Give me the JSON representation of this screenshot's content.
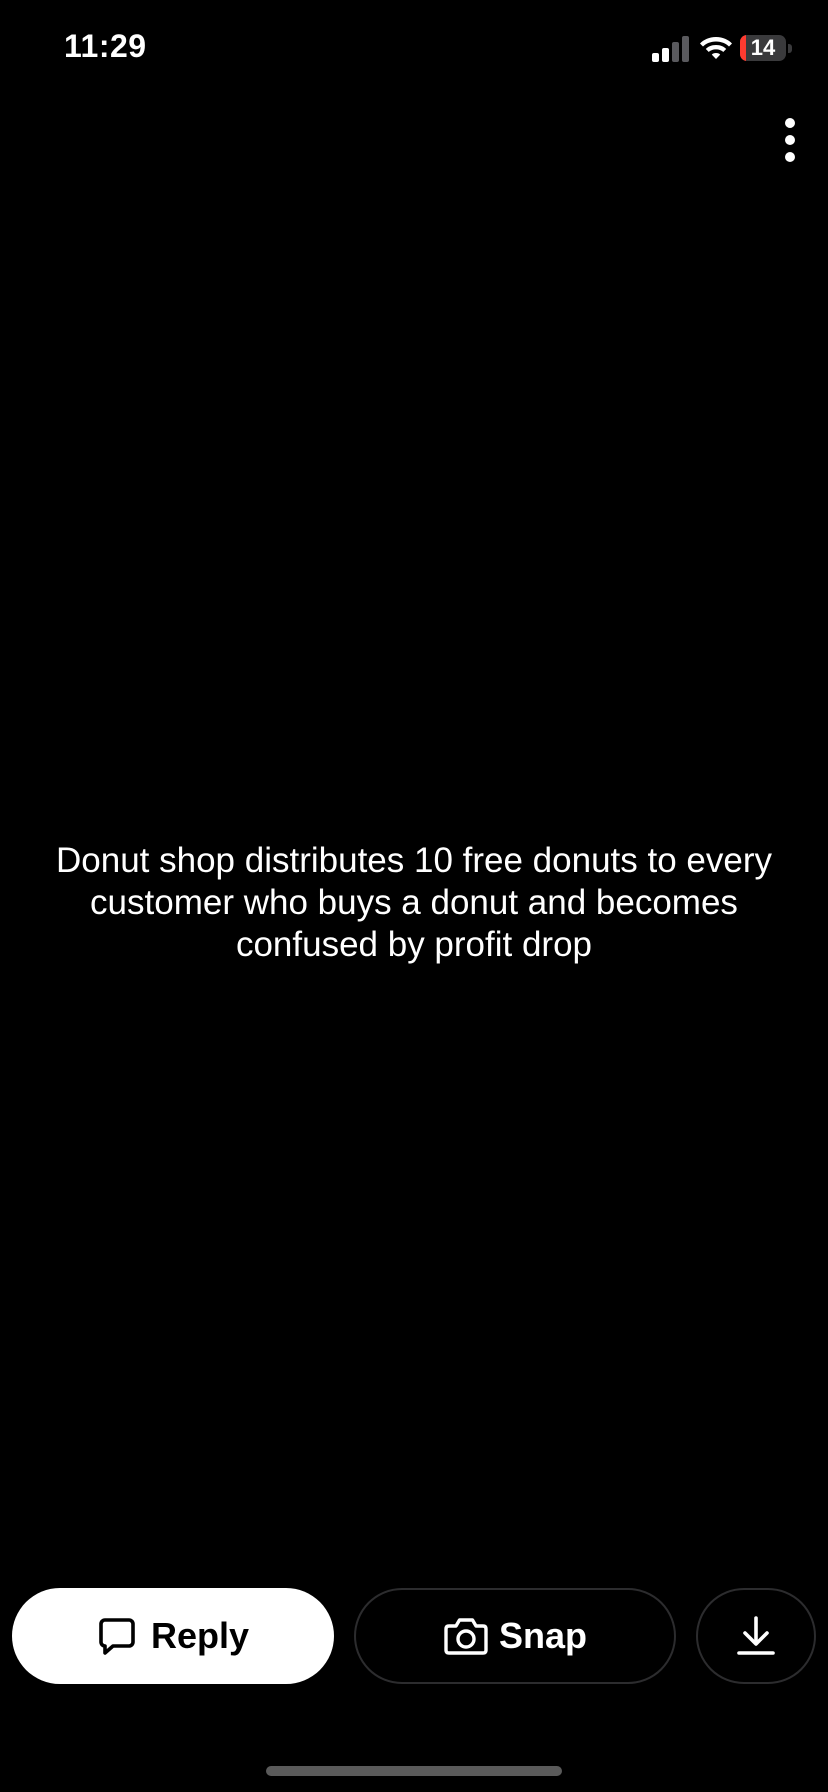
{
  "status_bar": {
    "time": "11:29",
    "battery_level": "14",
    "battery_fraction": 0.14,
    "battery_color": "#ff3b30",
    "signal_icon": "cellular-signal-icon",
    "wifi_icon": "wifi-icon"
  },
  "header": {
    "more_icon": "more-vertical-icon"
  },
  "story": {
    "caption": "Donut shop distributes 10 free donuts to every customer who buys a donut and becomes confused by profit drop"
  },
  "actions": {
    "reply_label": "Reply",
    "reply_icon": "chat-bubble-icon",
    "snap_label": "Snap",
    "snap_icon": "camera-icon",
    "download_icon": "download-icon"
  },
  "colors": {
    "background": "#000000",
    "reply_button_bg": "#ffffff",
    "outline": "#2c2c2e"
  }
}
